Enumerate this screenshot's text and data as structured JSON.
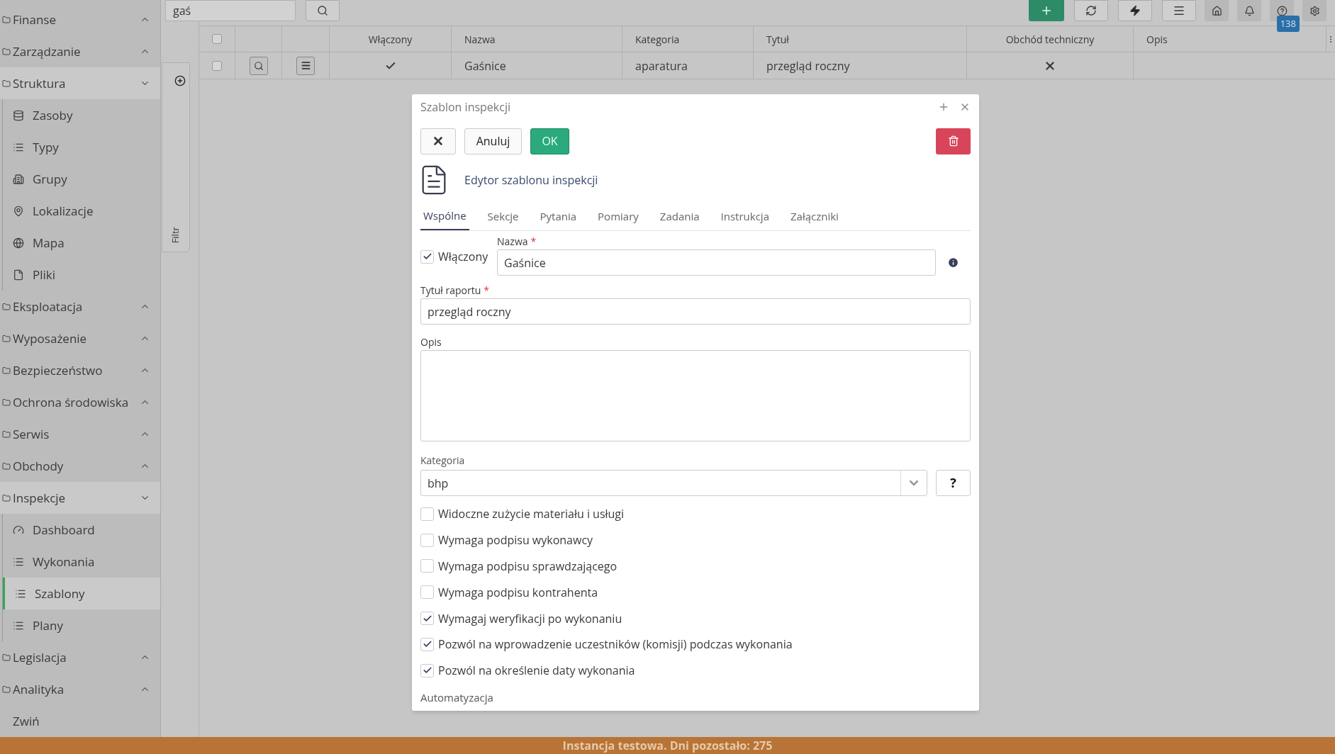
{
  "sidebar": {
    "items": [
      {
        "label": "Finanse",
        "expanded": false
      },
      {
        "label": "Zarządzanie",
        "expanded": false
      },
      {
        "label": "Struktura",
        "expanded": true,
        "children": [
          {
            "label": "Zasoby",
            "selected": false
          },
          {
            "label": "Typy",
            "selected": false
          },
          {
            "label": "Grupy",
            "selected": false
          },
          {
            "label": "Lokalizacje",
            "selected": false
          },
          {
            "label": "Mapa",
            "selected": false
          },
          {
            "label": "Pliki",
            "selected": false
          }
        ]
      },
      {
        "label": "Eksploatacja",
        "expanded": false
      },
      {
        "label": "Wyposażenie",
        "expanded": false
      },
      {
        "label": "Bezpieczeństwo",
        "expanded": false
      },
      {
        "label": "Ochrona środowiska",
        "expanded": false
      },
      {
        "label": "Serwis",
        "expanded": false
      },
      {
        "label": "Obchody",
        "expanded": false
      },
      {
        "label": "Inspekcje",
        "expanded": true,
        "children": [
          {
            "label": "Dashboard",
            "selected": false
          },
          {
            "label": "Wykonania",
            "selected": false
          },
          {
            "label": "Szablony",
            "selected": true
          },
          {
            "label": "Plany",
            "selected": false
          }
        ]
      },
      {
        "label": "Legislacja",
        "expanded": false
      },
      {
        "label": "Analityka",
        "expanded": false
      }
    ],
    "collapse": "Zwiń"
  },
  "filter_tab": "Filtr",
  "search": {
    "value": "gaś"
  },
  "notifications_badge": "138",
  "table": {
    "all_checked": false,
    "columns": [
      "Włączony",
      "Nazwa",
      "Kategoria",
      "Tytuł",
      "Obchód techniczny",
      "Opis"
    ],
    "rows": [
      {
        "checked": false,
        "enabled": true,
        "name": "Gaśnice",
        "category": "aparatura",
        "title": "przegląd roczny",
        "technical_round": false
      }
    ]
  },
  "dialog": {
    "title": "Szablon inspekcji",
    "cancel": "Anuluj",
    "ok": "OK",
    "heading": "Edytor szablonu inspekcji",
    "tabs": [
      {
        "label": "Wspólne",
        "selected": true
      },
      {
        "label": "Sekcje",
        "selected": false
      },
      {
        "label": "Pytania",
        "selected": false
      },
      {
        "label": "Pomiary",
        "selected": false
      },
      {
        "label": "Zadania",
        "selected": false
      },
      {
        "label": "Instrukcja",
        "selected": false
      },
      {
        "label": "Załączniki",
        "selected": false
      }
    ],
    "enabled": {
      "label": "Włączony",
      "checked": true
    },
    "name": {
      "label": "Nazwa",
      "required_mark": "*",
      "value": "Gaśnice"
    },
    "report_title": {
      "label": "Tytuł raportu",
      "required_mark": "*",
      "value": "przegląd roczny"
    },
    "description": {
      "label": "Opis"
    },
    "category": {
      "label": "Kategoria",
      "value": "bhp",
      "help": "?"
    },
    "options": [
      {
        "label": "Widoczne zużycie materiału i usługi",
        "checked": false
      },
      {
        "label": "Wymaga podpisu wykonawcy",
        "checked": false
      },
      {
        "label": "Wymaga podpisu sprawdzającego",
        "checked": false
      },
      {
        "label": "Wymaga podpisu kontrahenta",
        "checked": false
      },
      {
        "label": "Wymagaj weryfikacji po wykonaniu",
        "checked": true
      },
      {
        "label": "Pozwól na wprowadzenie uczestników (komisji) podczas wykonania",
        "checked": true
      },
      {
        "label": "Pozwól na określenie daty wykonania",
        "checked": true
      }
    ],
    "next_section": "Automatyzacja"
  },
  "status_bar": "Instancja testowa. Dni pozostało: 275"
}
